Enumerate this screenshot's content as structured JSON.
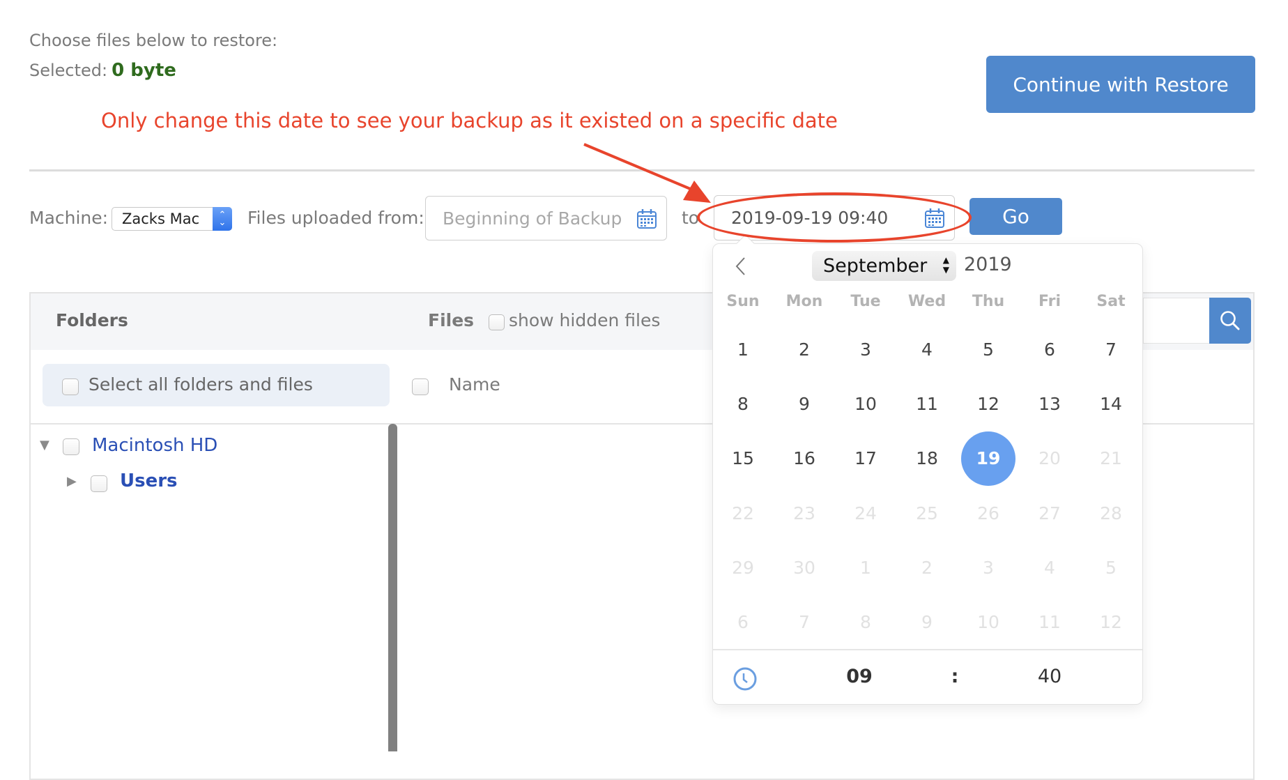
{
  "intro": {
    "choose_text": "Choose files below to restore:",
    "selected_label": "Selected:",
    "selected_value": "0 byte"
  },
  "annotation": {
    "text": "Only change this date to see your backup as it existed on a specific date",
    "color": "#e8442c"
  },
  "actions": {
    "continue_label": "Continue with Restore",
    "go_label": "Go"
  },
  "filters": {
    "machine_label": "Machine:",
    "machine_value": "Zacks Mac",
    "from_label": "Files uploaded from:",
    "from_placeholder": "Beginning of Backup",
    "to_label": "to",
    "to_value": "2019-09-19 09:40"
  },
  "panel": {
    "folders_header": "Folders",
    "files_header": "Files",
    "show_hidden_label": "show hidden files",
    "select_all_label": "Select all folders and files",
    "name_column": "Name",
    "tree": [
      {
        "label": "Macintosh HD",
        "expanded": true
      },
      {
        "label": "Users",
        "expanded": false
      }
    ]
  },
  "calendar": {
    "month": "September",
    "year": "2019",
    "weekdays": [
      "Sun",
      "Mon",
      "Tue",
      "Wed",
      "Thu",
      "Fri",
      "Sat"
    ],
    "weeks": [
      [
        {
          "d": "1"
        },
        {
          "d": "2"
        },
        {
          "d": "3"
        },
        {
          "d": "4"
        },
        {
          "d": "5"
        },
        {
          "d": "6"
        },
        {
          "d": "7"
        }
      ],
      [
        {
          "d": "8"
        },
        {
          "d": "9"
        },
        {
          "d": "10"
        },
        {
          "d": "11"
        },
        {
          "d": "12"
        },
        {
          "d": "13"
        },
        {
          "d": "14"
        }
      ],
      [
        {
          "d": "15"
        },
        {
          "d": "16"
        },
        {
          "d": "17"
        },
        {
          "d": "18"
        },
        {
          "d": "19",
          "selected": true
        },
        {
          "d": "20",
          "disabled": true
        },
        {
          "d": "21",
          "disabled": true
        }
      ],
      [
        {
          "d": "22",
          "disabled": true
        },
        {
          "d": "23",
          "disabled": true
        },
        {
          "d": "24",
          "disabled": true
        },
        {
          "d": "25",
          "disabled": true
        },
        {
          "d": "26",
          "disabled": true
        },
        {
          "d": "27",
          "disabled": true
        },
        {
          "d": "28",
          "disabled": true
        }
      ],
      [
        {
          "d": "29",
          "disabled": true
        },
        {
          "d": "30",
          "disabled": true
        },
        {
          "d": "1",
          "disabled": true
        },
        {
          "d": "2",
          "disabled": true
        },
        {
          "d": "3",
          "disabled": true
        },
        {
          "d": "4",
          "disabled": true
        },
        {
          "d": "5",
          "disabled": true
        }
      ],
      [
        {
          "d": "6",
          "disabled": true
        },
        {
          "d": "7",
          "disabled": true
        },
        {
          "d": "8",
          "disabled": true
        },
        {
          "d": "9",
          "disabled": true
        },
        {
          "d": "10",
          "disabled": true
        },
        {
          "d": "11",
          "disabled": true
        },
        {
          "d": "12",
          "disabled": true
        }
      ]
    ],
    "hour": "09",
    "separator": ":",
    "minute": "40",
    "accent_color": "#68a0ef"
  },
  "icons": {
    "calendar": "calendar-icon",
    "search": "search-icon",
    "clock": "clock-icon",
    "prev": "chevron-left-icon"
  }
}
